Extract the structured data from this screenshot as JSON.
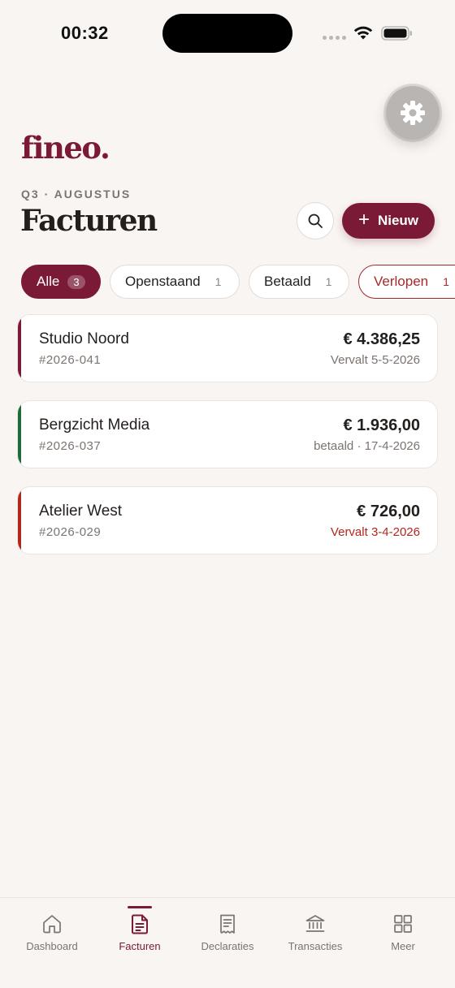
{
  "status_bar": {
    "time": "00:32"
  },
  "settings": {
    "icon": "gear-icon"
  },
  "brand": {
    "logo": "fineo."
  },
  "header": {
    "period": "Q3 · AUGUSTUS",
    "title": "Facturen",
    "search_icon": "search-icon",
    "new_label": "Nieuw",
    "new_icon": "+"
  },
  "filters": [
    {
      "label": "Alle",
      "count": "3",
      "active": true
    },
    {
      "label": "Openstaand",
      "count": "1",
      "active": false
    },
    {
      "label": "Betaald",
      "count": "1",
      "active": false
    },
    {
      "label": "Verlopen",
      "count": "1",
      "active": false
    }
  ],
  "invoices": [
    {
      "client": "Studio Noord",
      "number": "#2026-041",
      "amount": "€ 4.386,25",
      "status": "Vervalt 5-5-2026",
      "state": "open",
      "color": "#7a1a37"
    },
    {
      "client": "Bergzicht Media",
      "number": "#2026-037",
      "amount": "€ 1.936,00",
      "status": "betaald · 17-4-2026",
      "state": "paid",
      "color": "#1e6b3a"
    },
    {
      "client": "Atelier West",
      "number": "#2026-029",
      "amount": "€ 726,00",
      "status": "Vervalt 3-4-2026",
      "state": "overdue",
      "color": "#b3261e"
    }
  ],
  "nav": [
    {
      "label": "Dashboard",
      "icon": "home-icon",
      "active": false
    },
    {
      "label": "Facturen",
      "icon": "document-icon",
      "active": true
    },
    {
      "label": "Declaraties",
      "icon": "receipt-icon",
      "active": false
    },
    {
      "label": "Transacties",
      "icon": "bank-icon",
      "active": false
    },
    {
      "label": "Meer",
      "icon": "grid-icon",
      "active": false
    }
  ],
  "colors": {
    "brand": "#7a1a37",
    "background": "#f9f5f2",
    "paid": "#1e6b3a",
    "overdue": "#b3261e"
  }
}
